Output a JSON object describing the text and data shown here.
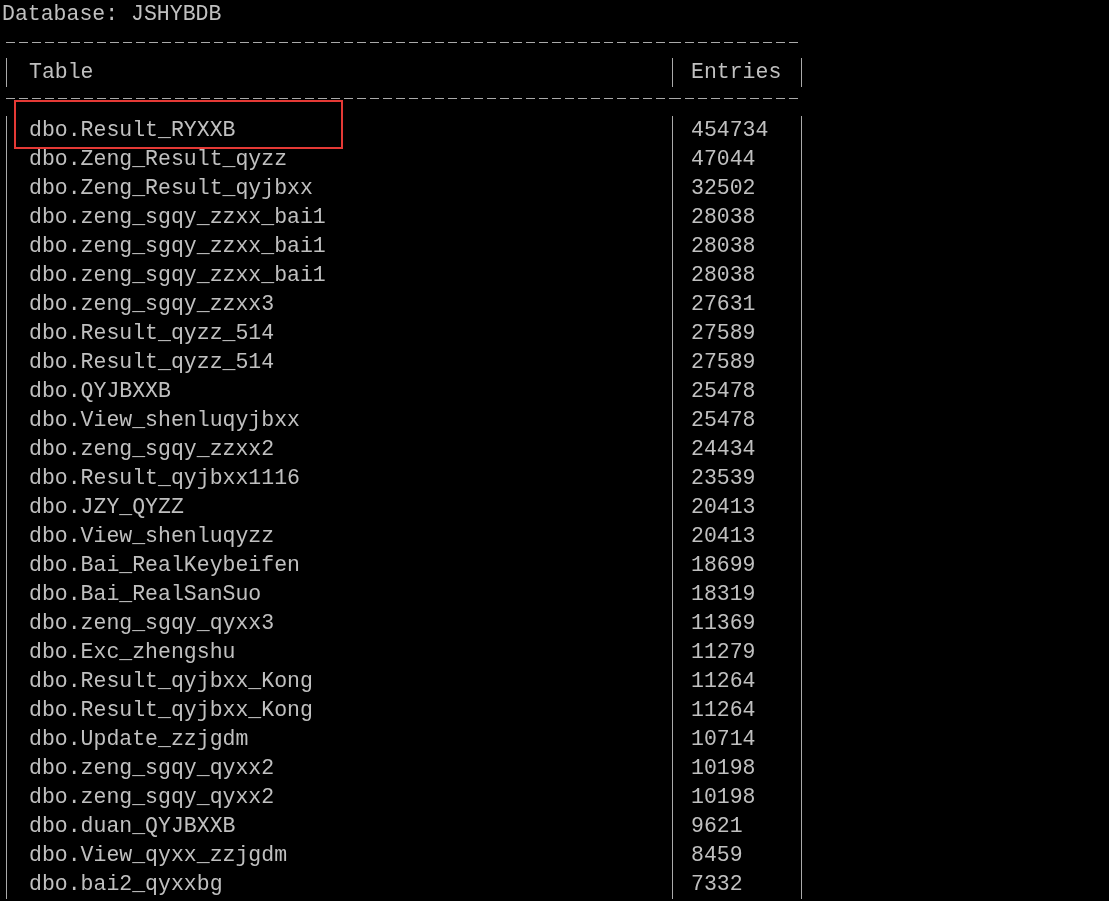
{
  "database_line": "Database: JSHYBDB",
  "table": {
    "columns": [
      "Table",
      "Entries"
    ],
    "rows": [
      {
        "name": "dbo.Result_RYXXB",
        "entries": "454734",
        "highlighted": true
      },
      {
        "name": "dbo.Zeng_Result_qyzz",
        "entries": "47044",
        "highlighted": false
      },
      {
        "name": "dbo.Zeng_Result_qyjbxx",
        "entries": "32502",
        "highlighted": false
      },
      {
        "name": "dbo.zeng_sgqy_zzxx_bai1",
        "entries": "28038",
        "highlighted": false
      },
      {
        "name": "dbo.zeng_sgqy_zzxx_bai1",
        "entries": "28038",
        "highlighted": false
      },
      {
        "name": "dbo.zeng_sgqy_zzxx_bai1",
        "entries": "28038",
        "highlighted": false
      },
      {
        "name": "dbo.zeng_sgqy_zzxx3",
        "entries": "27631",
        "highlighted": false
      },
      {
        "name": "dbo.Result_qyzz_514",
        "entries": "27589",
        "highlighted": false
      },
      {
        "name": "dbo.Result_qyzz_514",
        "entries": "27589",
        "highlighted": false
      },
      {
        "name": "dbo.QYJBXXB",
        "entries": "25478",
        "highlighted": false
      },
      {
        "name": "dbo.View_shenluqyjbxx",
        "entries": "25478",
        "highlighted": false
      },
      {
        "name": "dbo.zeng_sgqy_zzxx2",
        "entries": "24434",
        "highlighted": false
      },
      {
        "name": "dbo.Result_qyjbxx1116",
        "entries": "23539",
        "highlighted": false
      },
      {
        "name": "dbo.JZY_QYZZ",
        "entries": "20413",
        "highlighted": false
      },
      {
        "name": "dbo.View_shenluqyzz",
        "entries": "20413",
        "highlighted": false
      },
      {
        "name": "dbo.Bai_RealKeybeifen",
        "entries": "18699",
        "highlighted": false
      },
      {
        "name": "dbo.Bai_RealSanSuo",
        "entries": "18319",
        "highlighted": false
      },
      {
        "name": "dbo.zeng_sgqy_qyxx3",
        "entries": "11369",
        "highlighted": false
      },
      {
        "name": "dbo.Exc_zhengshu",
        "entries": "11279",
        "highlighted": false
      },
      {
        "name": "dbo.Result_qyjbxx_Kong",
        "entries": "11264",
        "highlighted": false
      },
      {
        "name": "dbo.Result_qyjbxx_Kong",
        "entries": "11264",
        "highlighted": false
      },
      {
        "name": "dbo.Update_zzjgdm",
        "entries": "10714",
        "highlighted": false
      },
      {
        "name": "dbo.zeng_sgqy_qyxx2",
        "entries": "10198",
        "highlighted": false
      },
      {
        "name": "dbo.zeng_sgqy_qyxx2",
        "entries": "10198",
        "highlighted": false
      },
      {
        "name": "dbo.duan_QYJBXXB",
        "entries": "9621",
        "highlighted": false
      },
      {
        "name": "dbo.View_qyxx_zzjgdm",
        "entries": "8459",
        "highlighted": false
      },
      {
        "name": "dbo.bai2_qyxxbg",
        "entries": "7332",
        "highlighted": false
      }
    ]
  }
}
